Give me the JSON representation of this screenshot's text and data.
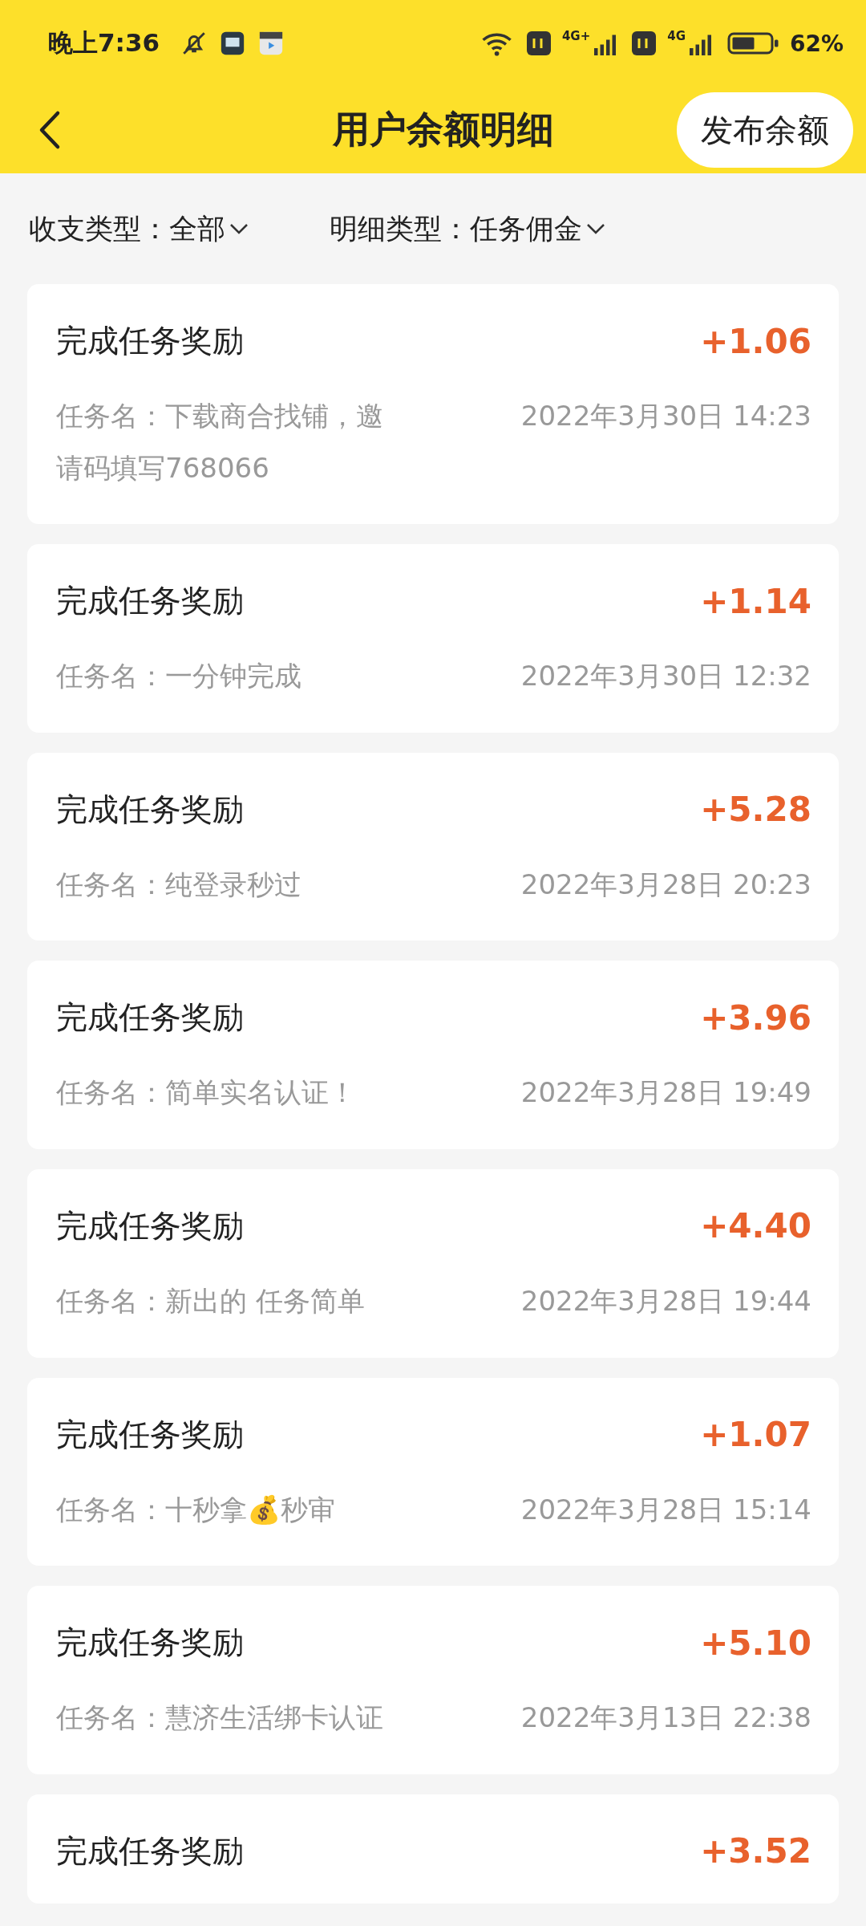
{
  "status_bar": {
    "time": "晚上7:36",
    "network_1": "4G+",
    "network_2": "4G",
    "battery": "62%"
  },
  "header": {
    "title": "用户余额明细",
    "action": "发布余额"
  },
  "filters": [
    {
      "label": "收支类型：",
      "value": "全部"
    },
    {
      "label": "明细类型：",
      "value": "任务佣金"
    }
  ],
  "records": [
    {
      "title": "完成任务奖励",
      "amount": "+1.06",
      "task": "任务名：下载商合找铺，邀请码填写768066",
      "date": "2022年3月30日 14:23"
    },
    {
      "title": "完成任务奖励",
      "amount": "+1.14",
      "task": "任务名：一分钟完成",
      "date": "2022年3月30日 12:32"
    },
    {
      "title": "完成任务奖励",
      "amount": "+5.28",
      "task": "任务名：纯登录秒过",
      "date": "2022年3月28日 20:23"
    },
    {
      "title": "完成任务奖励",
      "amount": "+3.96",
      "task": "任务名：简单实名认证！",
      "date": "2022年3月28日 19:49"
    },
    {
      "title": "完成任务奖励",
      "amount": "+4.40",
      "task": "任务名：新出的  任务简单",
      "date": "2022年3月28日 19:44"
    },
    {
      "title": "完成任务奖励",
      "amount": "+1.07",
      "task": "任务名：十秒拿💰秒审",
      "date": "2022年3月28日 15:14"
    },
    {
      "title": "完成任务奖励",
      "amount": "+5.10",
      "task": "任务名：慧济生活绑卡认证",
      "date": "2022年3月13日 22:38"
    },
    {
      "title": "完成任务奖励",
      "amount": "+3.52"
    }
  ]
}
